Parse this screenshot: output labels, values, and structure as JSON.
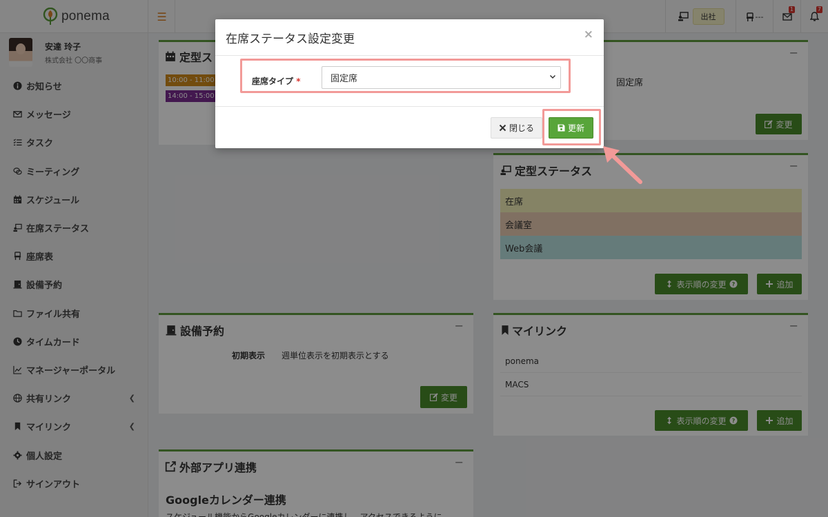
{
  "app": {
    "name": "ponema"
  },
  "header": {
    "status_chip": "出社",
    "seat_value": "---",
    "message_badge": "1",
    "notification_badge": "7"
  },
  "user": {
    "name": "安達 玲子",
    "company": "株式会社 〇〇商事"
  },
  "sidebar": {
    "items": [
      {
        "label": "お知らせ",
        "icon": "info-icon"
      },
      {
        "label": "メッセージ",
        "icon": "envelope-icon"
      },
      {
        "label": "タスク",
        "icon": "list-icon"
      },
      {
        "label": "ミーティング",
        "icon": "comments-icon"
      },
      {
        "label": "スケジュール",
        "icon": "calendar-icon"
      },
      {
        "label": "在席ステータス",
        "icon": "presence-icon"
      },
      {
        "label": "座席表",
        "icon": "chair-icon"
      },
      {
        "label": "設備予約",
        "icon": "door-icon"
      },
      {
        "label": "ファイル共有",
        "icon": "folder-icon"
      },
      {
        "label": "タイムカード",
        "icon": "clock-icon"
      },
      {
        "label": "マネージャーポータル",
        "icon": "chart-icon"
      },
      {
        "label": "共有リンク",
        "icon": "globe-icon"
      },
      {
        "label": "マイリンク",
        "icon": "bookmark-icon"
      },
      {
        "label": "個人設定",
        "icon": "gear-icon"
      },
      {
        "label": "サインアウト",
        "icon": "signout-icon"
      }
    ]
  },
  "panels": {
    "schedule": {
      "title": "定型ス",
      "events": [
        {
          "label": "10:00 - 11:00",
          "color": "#d08a1a"
        },
        {
          "label": "14:00 - 15:00",
          "color": "#7b2c91"
        }
      ]
    },
    "seat": {
      "value": "固定席",
      "change_label": "変更"
    },
    "status": {
      "title": "定型ステータス",
      "rows": [
        {
          "label": "在席",
          "color": "#f2efb8"
        },
        {
          "label": "会議室",
          "color": "#eacdb3"
        },
        {
          "label": "Web会議",
          "color": "#b9e1df"
        }
      ],
      "reorder_label": "表示順の変更",
      "add_label": "追加"
    },
    "facility": {
      "title": "設備予約",
      "setting_label": "初期表示",
      "setting_value": "週単位表示を初期表示とする",
      "change_label": "変更"
    },
    "mylink": {
      "title": "マイリンク",
      "links": [
        "ponema",
        "MACS"
      ],
      "reorder_label": "表示順の変更",
      "add_label": "追加"
    },
    "external": {
      "title": "外部アプリ連携",
      "subtitle": "Googleカレンダー連携",
      "text": "スケジュール機能からGoogleカレンダーに連携し、アクセスできるように"
    }
  },
  "modal": {
    "title": "在席ステータス設定変更",
    "field_label": "座席タイプ",
    "required_mark": "*",
    "select_value": "固定席",
    "close_label": "閉じる",
    "update_label": "更新"
  },
  "colors": {
    "accent_green": "#4a8a2a",
    "highlight": "#f29a98"
  }
}
